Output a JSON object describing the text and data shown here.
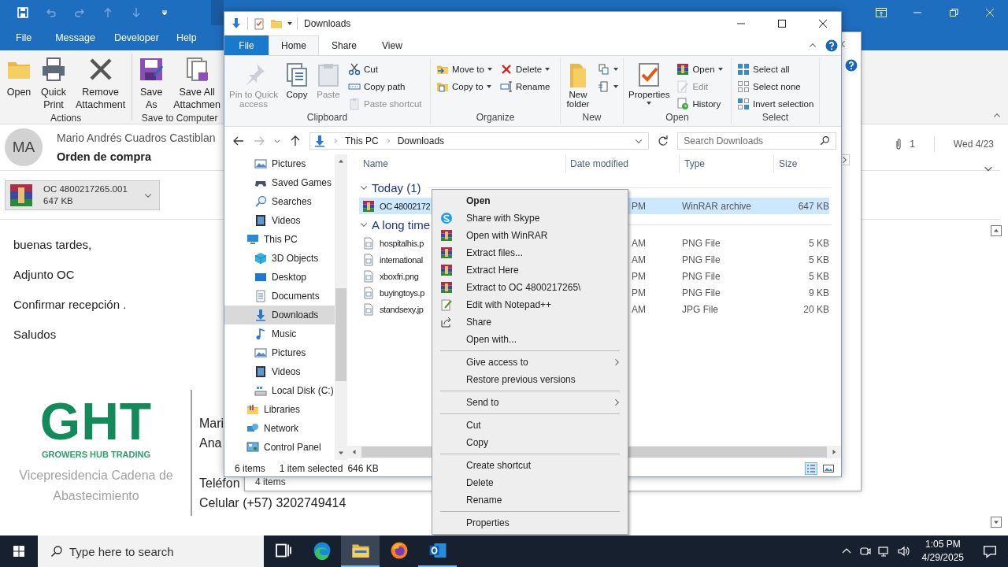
{
  "outlook": {
    "tabs": [
      "File",
      "Message",
      "Developer",
      "Help"
    ],
    "ribbon": [
      {
        "label": "Actions",
        "buttons": [
          "Open",
          "Quick\nPrint",
          "Remove\nAttachment"
        ]
      },
      {
        "label": "Save to Computer",
        "buttons": [
          "Save\nAs",
          "Save All\nAttachmen"
        ]
      }
    ],
    "message": {
      "initials": "MA",
      "sender": "Mario Andrés Cuadros Castiblan",
      "subject": "Orden de compra",
      "attachment_count": "1",
      "date": "Wed 4/23"
    },
    "attachment": {
      "name": "OC 4800217265.001",
      "size": "647 KB"
    },
    "body": [
      "buenas tardes,",
      "Adjunto OC",
      "Confirmar recepción .",
      "Saludos"
    ],
    "signature": {
      "logo": "GHT",
      "tagline": "GROWERS HUB TRADING",
      "department": "Vicepresidencia Cadena de Abastecimiento",
      "lines": [
        "Mari",
        "Ana",
        "Teléfon",
        "Celular (+57) 3202749414"
      ]
    }
  },
  "back_window": {
    "status": "4 items"
  },
  "explorer": {
    "title": "Downloads",
    "tabs": [
      {
        "label": "File",
        "kind": "file",
        "selected": false
      },
      {
        "label": "Home",
        "kind": "tab",
        "selected": true
      },
      {
        "label": "Share",
        "kind": "tab",
        "selected": false
      },
      {
        "label": "View",
        "kind": "tab",
        "selected": false
      }
    ],
    "ribbon": [
      {
        "label": "Clipboard",
        "items": [
          {
            "kind": "large",
            "label": "Pin to Quick\naccess",
            "disabled": true,
            "dropdown": false
          },
          {
            "kind": "large",
            "label": "Copy",
            "disabled": false,
            "dropdown": false
          },
          {
            "kind": "large",
            "label": "Paste",
            "disabled": true,
            "dropdown": false
          },
          {
            "kind": "column",
            "items": [
              {
                "label": "Cut",
                "disabled": false,
                "dropdown": false
              },
              {
                "label": "Copy path",
                "disabled": false,
                "dropdown": false
              },
              {
                "label": "Paste shortcut",
                "disabled": true,
                "dropdown": false
              }
            ]
          }
        ]
      },
      {
        "label": "Organize",
        "items": [
          {
            "kind": "column",
            "items": [
              {
                "label": "Move to",
                "disabled": false,
                "dropdown": true
              },
              {
                "label": "Copy to",
                "disabled": false,
                "dropdown": true
              }
            ]
          },
          {
            "kind": "column",
            "items": [
              {
                "label": "Delete",
                "disabled": false,
                "dropdown": true
              },
              {
                "label": "Rename",
                "disabled": false,
                "dropdown": false
              }
            ]
          }
        ]
      },
      {
        "label": "New",
        "items": [
          {
            "kind": "large",
            "label": "New\nfolder",
            "disabled": false,
            "dropdown": false
          },
          {
            "kind": "column",
            "items": [
              {
                "disabled": false,
                "dropdown": true
              },
              {
                "disabled": false,
                "dropdown": true
              }
            ]
          }
        ]
      },
      {
        "label": "Open",
        "items": [
          {
            "kind": "large",
            "label": "Properties",
            "disabled": false,
            "dropdown": true
          },
          {
            "kind": "column",
            "items": [
              {
                "label": "Open",
                "disabled": false,
                "dropdown": true
              },
              {
                "label": "Edit",
                "disabled": true,
                "dropdown": false
              },
              {
                "label": "History",
                "disabled": false,
                "dropdown": false
              }
            ]
          }
        ]
      },
      {
        "label": "Select",
        "items": [
          {
            "kind": "column",
            "items": [
              {
                "label": "Select all",
                "disabled": false,
                "dropdown": false
              },
              {
                "label": "Select none",
                "disabled": false,
                "dropdown": false
              },
              {
                "label": "Invert selection",
                "disabled": false,
                "dropdown": false
              }
            ]
          }
        ]
      }
    ],
    "address": [
      "This PC",
      "Downloads"
    ],
    "search_placeholder": "Search Downloads",
    "nav": [
      {
        "children": [
          {
            "label": "Pictures",
            "selected": false
          },
          {
            "label": "Saved Games",
            "selected": false
          },
          {
            "label": "Searches",
            "selected": false
          },
          {
            "label": "Videos",
            "selected": false
          }
        ]
      },
      {
        "label": "This PC",
        "selected": false,
        "children": [
          {
            "label": "3D Objects",
            "selected": false
          },
          {
            "label": "Desktop",
            "selected": false
          },
          {
            "label": "Documents",
            "selected": false
          },
          {
            "label": "Downloads",
            "selected": true
          },
          {
            "label": "Music",
            "selected": false
          },
          {
            "label": "Pictures",
            "selected": false
          },
          {
            "label": "Videos",
            "selected": false
          },
          {
            "label": "Local Disk (C:)",
            "selected": false
          }
        ]
      },
      {
        "label": "Libraries",
        "selected": false
      },
      {
        "label": "Network",
        "selected": false
      },
      {
        "label": "Control Panel",
        "selected": false
      }
    ],
    "columns": [
      "Name",
      "Date modified",
      "Type",
      "Size"
    ],
    "groups": [
      {
        "label": "Today (1)",
        "expanded": true,
        "files": [
          {
            "name": "OC 48002172",
            "date": "PM",
            "type": "WinRAR archive",
            "size": "647 KB",
            "kind": "archive",
            "selected": true
          }
        ]
      },
      {
        "label": "A long time",
        "expanded": true,
        "files": [
          {
            "name": "hospitalhis.p",
            "date": "AM",
            "type": "PNG File",
            "size": "5 KB",
            "kind": "image",
            "selected": false
          },
          {
            "name": "international",
            "date": "AM",
            "type": "PNG File",
            "size": "5 KB",
            "kind": "image",
            "selected": false
          },
          {
            "name": "xboxfri.png",
            "date": "PM",
            "type": "PNG File",
            "size": "5 KB",
            "kind": "image",
            "selected": false
          },
          {
            "name": "buyingtoys.p",
            "date": "PM",
            "type": "PNG File",
            "size": "9 KB",
            "kind": "image",
            "selected": false
          },
          {
            "name": "standsexy.jp",
            "date": "AM",
            "type": "JPG File",
            "size": "20 KB",
            "kind": "image",
            "selected": false
          }
        ]
      }
    ],
    "status": {
      "count": "6 items",
      "selection": "1 item selected",
      "size": "646 KB"
    }
  },
  "context_menu": [
    {
      "label": "Open",
      "kind": "default"
    },
    {
      "label": "Share with Skype",
      "kind": "skype"
    },
    {
      "label": "Open with WinRAR",
      "kind": "winrar"
    },
    {
      "label": "Extract files...",
      "kind": "winrar"
    },
    {
      "label": "Extract Here",
      "kind": "winrar"
    },
    {
      "label": "Extract to OC 4800217265\\",
      "kind": "winrar"
    },
    {
      "label": "Edit with Notepad++",
      "kind": "notepad"
    },
    {
      "label": "Share",
      "kind": "share"
    },
    {
      "label": "Open with...",
      "kind": "plain"
    },
    {
      "kind": "separator"
    },
    {
      "label": "Give access to",
      "kind": "submenu"
    },
    {
      "label": "Restore previous versions",
      "kind": "plain"
    },
    {
      "kind": "separator"
    },
    {
      "label": "Send to",
      "kind": "submenu"
    },
    {
      "kind": "separator"
    },
    {
      "label": "Cut",
      "kind": "plain"
    },
    {
      "label": "Copy",
      "kind": "plain"
    },
    {
      "kind": "separator"
    },
    {
      "label": "Create shortcut",
      "kind": "plain"
    },
    {
      "label": "Delete",
      "kind": "plain"
    },
    {
      "label": "Rename",
      "kind": "plain"
    },
    {
      "kind": "separator"
    },
    {
      "label": "Properties",
      "kind": "plain"
    }
  ],
  "taskbar": {
    "search_placeholder": "Type here to search",
    "apps": [
      {
        "kind": "taskview",
        "running": false,
        "selected": false
      },
      {
        "kind": "edge",
        "running": false,
        "selected": false
      },
      {
        "kind": "explorer",
        "running": true,
        "selected": true
      },
      {
        "kind": "firefox",
        "running": false,
        "selected": false
      },
      {
        "kind": "outlook",
        "running": true,
        "selected": false
      }
    ],
    "time": "1:05 PM",
    "date": "4/29/2025"
  }
}
